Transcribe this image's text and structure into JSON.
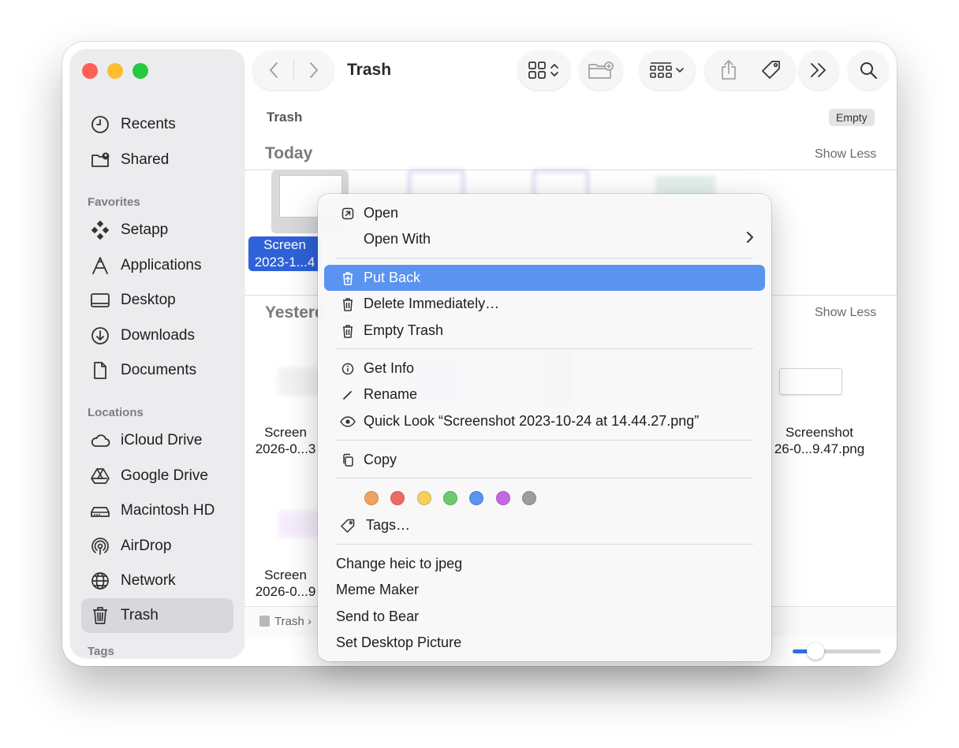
{
  "window": {
    "title": "Trash"
  },
  "sidebar": {
    "items_top": [
      {
        "label": "Recents",
        "icon": "clock-icon"
      },
      {
        "label": "Shared",
        "icon": "shared-folder-icon"
      }
    ],
    "favorites_header": "Favorites",
    "favorites": [
      {
        "label": "Setapp",
        "icon": "setapp-icon"
      },
      {
        "label": "Applications",
        "icon": "applications-icon"
      },
      {
        "label": "Desktop",
        "icon": "desktop-icon"
      },
      {
        "label": "Downloads",
        "icon": "download-icon"
      },
      {
        "label": "Documents",
        "icon": "document-icon"
      }
    ],
    "locations_header": "Locations",
    "locations": [
      {
        "label": "iCloud Drive",
        "icon": "cloud-icon"
      },
      {
        "label": "Google Drive",
        "icon": "google-drive-icon"
      },
      {
        "label": "Macintosh HD",
        "icon": "harddrive-icon"
      },
      {
        "label": "AirDrop",
        "icon": "airdrop-icon"
      },
      {
        "label": "Network",
        "icon": "globe-icon"
      },
      {
        "label": "Trash",
        "icon": "trash-icon",
        "active": true
      }
    ],
    "tags_header": "Tags"
  },
  "toolbar": {
    "back": "back-chevron-icon",
    "forward": "forward-chevron-icon",
    "view": "grid-view-icon",
    "new_folder": "new-folder-icon",
    "group": "group-by-icon",
    "share": "share-icon",
    "tag": "tag-icon",
    "more": "more-chevrons-icon",
    "search": "search-icon"
  },
  "content": {
    "path_label": "Trash",
    "empty_label": "Empty",
    "group_today": "Today",
    "group_yesterday": "Yesterd",
    "show_less": "Show Less",
    "selected_file_line1": "Screen",
    "selected_file_line2": "2023-1...4",
    "files": [
      {
        "line1": "Screen",
        "line2": "2026-0...3"
      },
      {
        "line1": "Screenshot",
        "line2": "26-0...9.47.png"
      },
      {
        "line1": "Screen",
        "line2": "2026-0...9"
      }
    ],
    "status_path": "Trash ›"
  },
  "context_menu": {
    "open": "Open",
    "open_with": "Open With",
    "put_back": "Put Back",
    "delete_immediately": "Delete Immediately…",
    "empty_trash": "Empty Trash",
    "get_info": "Get Info",
    "rename": "Rename",
    "quick_look": "Quick Look “Screenshot 2023-10-24 at 14.44.27.png”",
    "copy": "Copy",
    "tags": "Tags…",
    "change_heic": "Change heic to jpeg",
    "meme_maker": "Meme Maker",
    "send_to_bear": "Send to Bear",
    "set_desktop": "Set Desktop Picture",
    "tag_colors": [
      "#f0a35e",
      "#ee6a66",
      "#f5d05a",
      "#6cc970",
      "#5a93f0",
      "#c667e2",
      "#9c9ca1"
    ]
  }
}
